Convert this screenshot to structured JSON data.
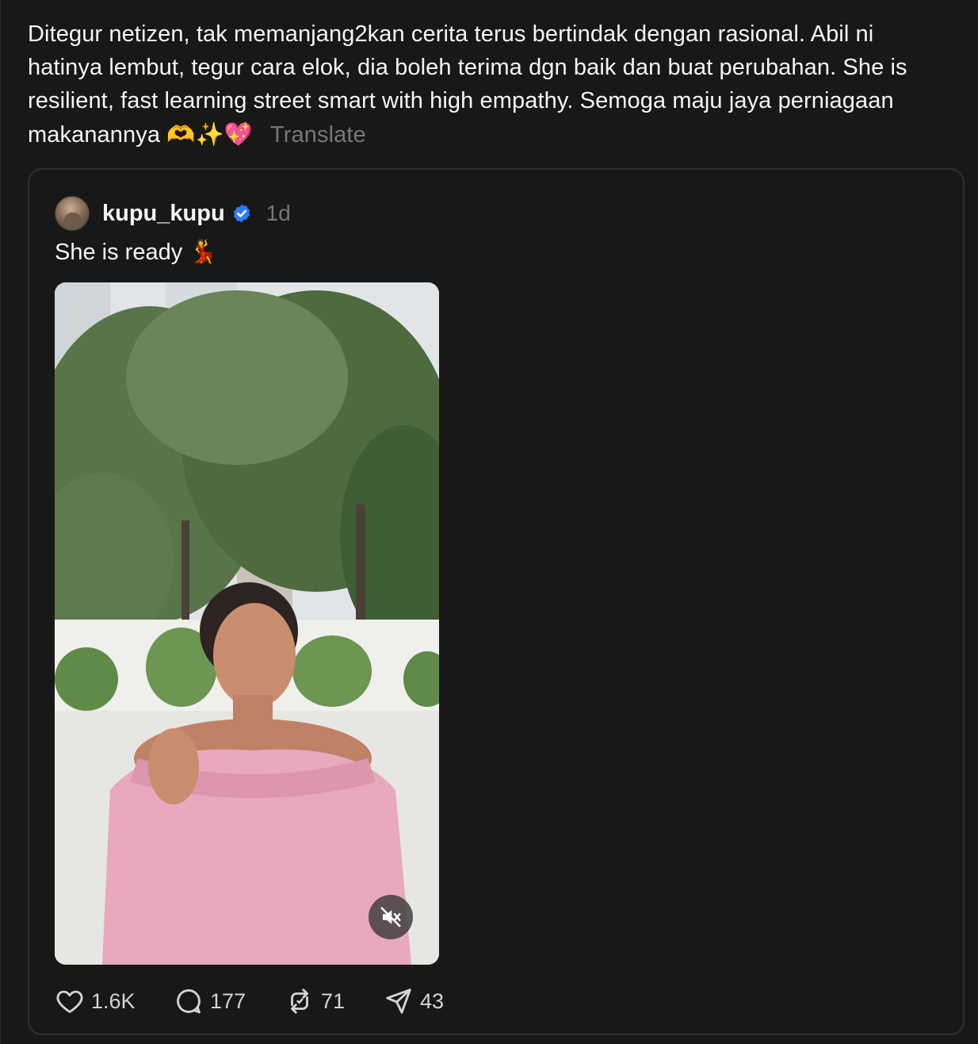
{
  "post": {
    "text_line1": "Ditegur netizen, tak memanjang2kan cerita terus bertindak dengan rasional. Abil ni",
    "text_line2": "hatinya lembut, tegur cara elok, dia boleh terima dgn baik dan buat perubahan. She is",
    "text_line3": "resilient, fast learning street smart with high empathy. Semoga maju jaya perniagaan",
    "text_line4": "makanannya",
    "emojis": "🫶✨💖",
    "translate_label": "Translate"
  },
  "quoted": {
    "username": "kupu_kupu",
    "verified_icon": "verified-badge-icon",
    "time": "1d",
    "text": "She is ready",
    "text_emoji": "💃",
    "media": {
      "type": "video",
      "mute_icon": "speaker-muted-icon",
      "description_colors": {
        "dress": "#e8a8bd",
        "foliage": "#4d6b3e",
        "wall": "#eeeeea"
      }
    }
  },
  "actions": {
    "likes": "1.6K",
    "replies": "177",
    "reposts": "71",
    "shares": "43",
    "icons": [
      "heart-icon",
      "comment-icon",
      "repost-icon",
      "share-icon"
    ]
  },
  "colors": {
    "background": "#181818",
    "text": "#f3f5f7",
    "muted": "#777777",
    "border": "#2f2f2f",
    "verified": "#2f7cf6"
  }
}
